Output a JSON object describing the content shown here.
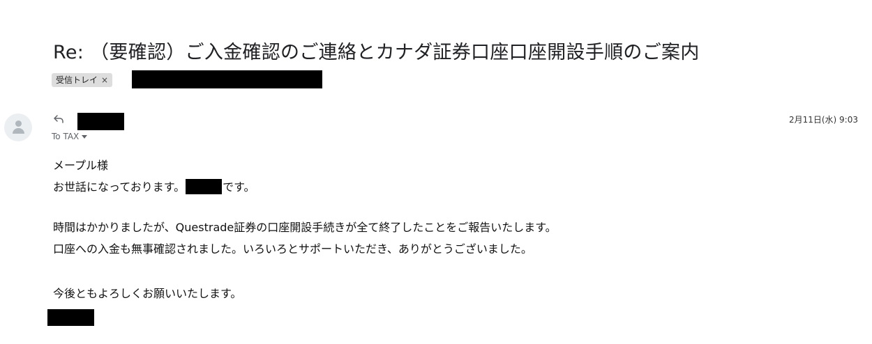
{
  "email": {
    "subject": "Re: （要確認）ご入金確認のご連絡とカナダ証券口座口座開設手順のご案内",
    "label_chip": "受信トレイ",
    "label_close": "×",
    "to_line": "To TAX",
    "date": "2月11日(水) 9:03",
    "body": {
      "greeting": "メープル様",
      "line1_before": "お世話になっております。",
      "line1_after": "です。",
      "para1_line1": "時間はかかりましたが、Questrade証券の口座開設手続きが全て終了したことをご報告いたします。",
      "para1_line2": "口座への入金も無事確認されました。いろいろとサポートいただき、ありがとうございました。",
      "closing": "今後ともよろしくお願いいたします。"
    }
  },
  "colors": {
    "chip_bg": "#dddddd",
    "redaction": "#000000",
    "avatar_bg": "#eceff1"
  }
}
